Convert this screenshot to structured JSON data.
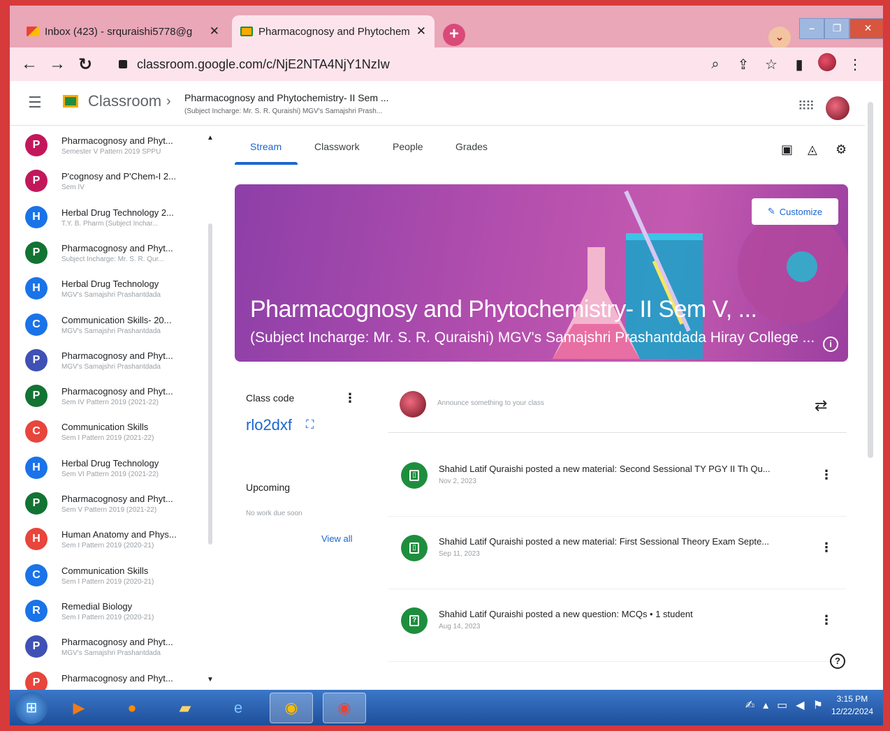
{
  "browser": {
    "tabs": [
      {
        "label": "Inbox (423) - srquraishi5778@g",
        "close": "✕"
      },
      {
        "label": "Pharmacognosy and Phytochem",
        "close": "✕"
      }
    ],
    "new_tab": "+",
    "tab_search": "⌄",
    "url": "classroom.google.com/c/NjE2NTA4NjY1NzIw"
  },
  "header": {
    "app_name": "Classroom",
    "separator": "›",
    "course_title": "Pharmacognosy and Phytochemistry- II Sem ...",
    "course_subtitle": "(Subject Incharge: Mr. S. R. Quraishi) MGV's Samajshri Prash..."
  },
  "sidebar": {
    "courses": [
      {
        "letter": "P",
        "color": "#c2185b",
        "name": "Pharmacognosy and Phyt...",
        "sub": "Semester V Pattern 2019 SPPU"
      },
      {
        "letter": "P",
        "color": "#c2185b",
        "name": "P'cognosy and P'Chem-I 2...",
        "sub": "Sem IV"
      },
      {
        "letter": "H",
        "color": "#1a73e8",
        "name": "Herbal Drug Technology 2...",
        "sub": "T.Y. B. Pharm (Subject Inchar..."
      },
      {
        "letter": "P",
        "color": "#137333",
        "name": "Pharmacognosy and Phyt...",
        "sub": "Subject Incharge: Mr. S. R. Qur..."
      },
      {
        "letter": "H",
        "color": "#1a73e8",
        "name": "Herbal Drug Technology",
        "sub": "MGV's Samajshri Prashantdada"
      },
      {
        "letter": "C",
        "color": "#1a73e8",
        "name": "Communication Skills- 20...",
        "sub": "MGV's Samajshri Prashantdada"
      },
      {
        "letter": "P",
        "color": "#3f51b5",
        "name": "Pharmacognosy and Phyt...",
        "sub": "MGV's Samajshri Prashantdada"
      },
      {
        "letter": "P",
        "color": "#137333",
        "name": "Pharmacognosy and Phyt...",
        "sub": "Sem IV Pattern 2019 (2021-22)"
      },
      {
        "letter": "C",
        "color": "#e8453c",
        "name": "Communication Skills",
        "sub": "Sem I Pattern 2019 (2021-22)"
      },
      {
        "letter": "H",
        "color": "#1a73e8",
        "name": "Herbal Drug Technology",
        "sub": "Sem VI Pattern 2019 (2021-22)"
      },
      {
        "letter": "P",
        "color": "#137333",
        "name": "Pharmacognosy and Phyt...",
        "sub": "Sem V Pattern 2019 (2021-22)"
      },
      {
        "letter": "H",
        "color": "#e8453c",
        "name": "Human Anatomy and Phys...",
        "sub": "Sem I Pattern 2019 (2020-21)"
      },
      {
        "letter": "C",
        "color": "#1a73e8",
        "name": "Communication Skills",
        "sub": "Sem I Pattern 2019 (2020-21)"
      },
      {
        "letter": "R",
        "color": "#1a73e8",
        "name": "Remedial Biology",
        "sub": "Sem I Pattern 2019 (2020-21)"
      },
      {
        "letter": "P",
        "color": "#3f51b5",
        "name": "Pharmacognosy and Phyt...",
        "sub": "MGV's Samajshri Prashantdada"
      },
      {
        "letter": "P",
        "color": "#e8453c",
        "name": "Pharmacognosy and Phyt...",
        "sub": ""
      }
    ]
  },
  "tabs": [
    "Stream",
    "Classwork",
    "People",
    "Grades"
  ],
  "banner": {
    "title": "Pharmacognosy and Phytochemistry- II Sem V, ...",
    "subtitle": "(Subject Incharge: Mr. S. R. Quraishi) MGV's Samajshri Prashantdada Hiray College ...",
    "customize_label": "Customize",
    "info": "i"
  },
  "class_code": {
    "label": "Class code",
    "value": "rlo2dxf"
  },
  "upcoming": {
    "label": "Upcoming",
    "empty": "No work due soon",
    "view_all": "View all"
  },
  "announce": {
    "placeholder": "Announce something to your class"
  },
  "posts": [
    {
      "text": "Shahid Latif Quraishi posted a new material: Second Sessional TY PGY II Th Qu...",
      "date": "Nov 2, 2023",
      "glyph": "▯"
    },
    {
      "text": "Shahid Latif Quraishi posted a new material: First Sessional Theory Exam Septe...",
      "date": "Sep 11, 2023",
      "glyph": "▯"
    },
    {
      "text": "Shahid Latif Quraishi posted a new question: MCQs  •  1 student",
      "date": "Aug 14, 2023",
      "glyph": "?"
    }
  ],
  "taskbar": {
    "time": "3:15 PM",
    "date": "12/22/2024"
  }
}
